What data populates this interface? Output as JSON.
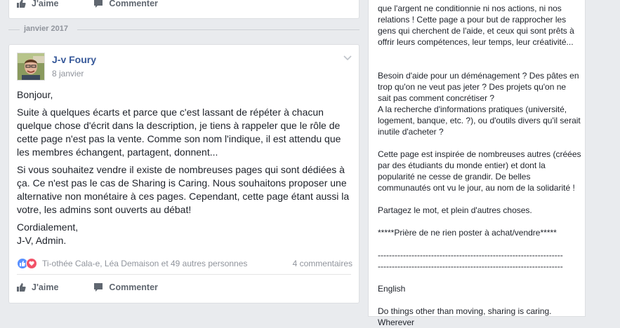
{
  "top_card": {
    "like_label": "J'aime",
    "comment_label": "Commenter"
  },
  "date_separator": "janvier 2017",
  "post": {
    "author": "J-v Foury",
    "date": "8 janvier",
    "paragraphs": [
      "Bonjour,",
      "Suite à quelques écarts et parce que c'est lassant de répéter à chacun quelque chose d'écrit dans la description, je tiens à rappeler que le rôle de cette page n'est pas la vente. Comme son nom l'indique, il est attendu que les membres échangent, partagent, donnent...",
      "Si vous souhaitez vendre il existe de nombreuses pages qui sont dédiées à ça. Ce n'est pas le cas de Sharing is Caring. Nous souhaitons proposer une alternative non monétaire à ces pages. Cependant, cette page étant aussi la votre, les admins sont ouverts au débat!",
      "Cordialement,\nJ-V, Admin."
    ],
    "reactions_text": "Ti-othée Cala-e, Léa Demaison et 49 autres personnes",
    "comments_count": "4 commentaires",
    "like_label": "J'aime",
    "comment_label": "Commenter"
  },
  "sidebar": {
    "lines": [
      "que l'argent ne conditionnie ni nos actions, ni nos relations ! Cette page a pour but de rapprocher les gens qui cherchent de l'aide, et ceux qui sont prêts à offrir leurs compétences, leur temps, leur créativité...",
      "",
      "",
      "Besoin d'aide pour un déménagement ? Des pâtes en trop qu'on ne veut pas jeter ? Des projets qu'on ne sait pas comment concrétiser ?",
      "A la recherche d'informations pratiques (université, logement, banque, etc. ?), ou d'outils divers qu'il serait inutile d'acheter ?",
      "",
      "Cette page est inspirée de nombreuses autres (créées par des étudiants du monde entier) et dont la popularité ne cesse de grandir. De belles communautés ont vu le jour, au nom de la solidarité !",
      "",
      "Partagez le mot, et plein d'autres choses.",
      "",
      "*****Prière de ne rien poster à achat/vendre*****",
      "",
      "------------------------------------------------------------------",
      "------------------------------------------------------------------",
      "",
      "English",
      "",
      "Do things other than moving, sharing is caring. Wherever"
    ]
  },
  "colors": {
    "background": "#e9ebee",
    "link_blue": "#365899",
    "muted": "#90949c",
    "like_blue": "#5890ff",
    "love_red": "#f25268"
  }
}
